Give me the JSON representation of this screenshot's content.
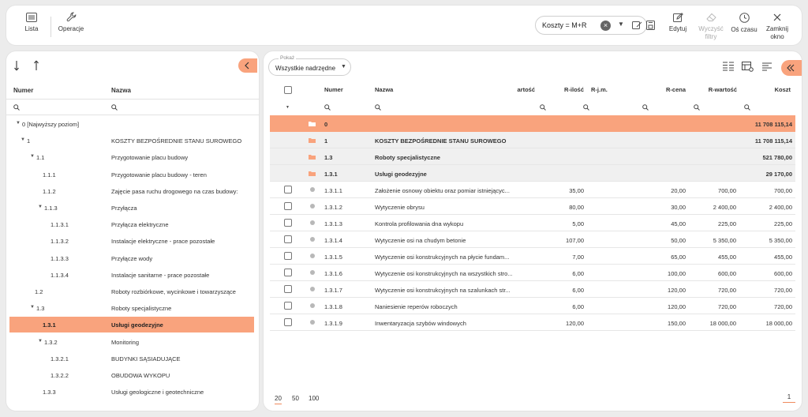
{
  "toolbar": {
    "lista": "Lista",
    "operacje": "Operacje",
    "formula": "Koszty = M+R",
    "edytuj": "Edytuj",
    "wyczysc_1": "Wyczyść",
    "wyczysc_2": "filtry",
    "os_czasu": "Oś czasu",
    "zamknij_1": "Zamknij",
    "zamknij_2": "okno"
  },
  "tree": {
    "col_numer": "Numer",
    "col_nazwa": "Nazwa",
    "rows": [
      {
        "num": "0 [Najwyższy poziom]",
        "name": "",
        "level": 0,
        "expanded": true
      },
      {
        "num": "1",
        "name": "KOSZTY BEZPOŚREDNIE STANU SUROWEGO",
        "level": 1,
        "expanded": true
      },
      {
        "num": "1.1",
        "name": "Przygotowanie placu budowy",
        "level": 2,
        "expanded": true
      },
      {
        "num": "1.1.1",
        "name": "Przygotowanie placu budowy - teren",
        "level": 3
      },
      {
        "num": "1.1.2",
        "name": "Zajęcie pasa ruchu drogowego na czas budowy:",
        "level": 3
      },
      {
        "num": "1.1.3",
        "name": "Przyłącza",
        "level": 3,
        "expanded": true
      },
      {
        "num": "1.1.3.1",
        "name": "Przyłącza elektryczne",
        "level": 4
      },
      {
        "num": "1.1.3.2",
        "name": "Instalacje elektryczne - prace pozostałe",
        "level": 4
      },
      {
        "num": "1.1.3.3",
        "name": "Przyłącze wody",
        "level": 4
      },
      {
        "num": "1.1.3.4",
        "name": "Instalacje sanitarne - prace pozostałe",
        "level": 4
      },
      {
        "num": "1.2",
        "name": "Roboty rozbiórkowe, wycinkowe i towarzyszące",
        "level": 2
      },
      {
        "num": "1.3",
        "name": "Roboty specjalistyczne",
        "level": 2,
        "expanded": true
      },
      {
        "num": "1.3.1",
        "name": "Usługi geodezyjne",
        "level": 3,
        "selected": true
      },
      {
        "num": "1.3.2",
        "name": "Monitoring",
        "level": 3,
        "expanded": true
      },
      {
        "num": "1.3.2.1",
        "name": "BUDYNKI SĄSIADUJĄCE",
        "level": 4
      },
      {
        "num": "1.3.2.2",
        "name": "OBUDOWA WYKOPU",
        "level": 4
      },
      {
        "num": "1.3.3",
        "name": "Usługi geologiczne i geotechniczne",
        "level": 3
      }
    ]
  },
  "grid": {
    "pokaz_label": "Pokaż",
    "pokaz_value": "Wszystkie nadrzędne",
    "columns": {
      "numer": "Numer",
      "nazwa": "Nazwa",
      "wartosc": "artość",
      "r_ilosc": "R-ilość",
      "r_jm": "R-j.m.",
      "r_cena": "R-cena",
      "r_wartosc": "R-wartość",
      "koszt": "Koszt"
    },
    "group_rows": [
      {
        "num": "0",
        "name": "",
        "koszt": "11 708 115,14",
        "style": "root"
      },
      {
        "num": "1",
        "name": "KOSZTY BEZPOŚREDNIE STANU SUROWEGO",
        "koszt": "11 708 115,14",
        "style": "group"
      },
      {
        "num": "1.3",
        "name": "Roboty specjalistyczne",
        "koszt": "521 780,00",
        "style": "group"
      },
      {
        "num": "1.3.1",
        "name": "Usługi geodezyjne",
        "koszt": "29 170,00",
        "style": "group"
      }
    ],
    "rows": [
      {
        "num": "1.3.1.1",
        "name": "Założenie osnowy obiektu oraz pomiar istniejącyc...",
        "r_ilosc": "35,00",
        "r_cena": "20,00",
        "r_wartosc": "700,00",
        "koszt": "700,00"
      },
      {
        "num": "1.3.1.2",
        "name": "Wytyczenie obrysu",
        "r_ilosc": "80,00",
        "r_cena": "30,00",
        "r_wartosc": "2 400,00",
        "koszt": "2 400,00"
      },
      {
        "num": "1.3.1.3",
        "name": "Kontrola profilowania dna wykopu",
        "r_ilosc": "5,00",
        "r_cena": "45,00",
        "r_wartosc": "225,00",
        "koszt": "225,00"
      },
      {
        "num": "1.3.1.4",
        "name": "Wytyczenie osi na chudym betonie",
        "r_ilosc": "107,00",
        "r_cena": "50,00",
        "r_wartosc": "5 350,00",
        "koszt": "5 350,00"
      },
      {
        "num": "1.3.1.5",
        "name": "Wytyczenie osi konstrukcyjnych na płycie fundam...",
        "r_ilosc": "7,00",
        "r_cena": "65,00",
        "r_wartosc": "455,00",
        "koszt": "455,00"
      },
      {
        "num": "1.3.1.6",
        "name": "Wytyczenie osi konstrukcyjnych na wszystkich stro...",
        "r_ilosc": "6,00",
        "r_cena": "100,00",
        "r_wartosc": "600,00",
        "koszt": "600,00"
      },
      {
        "num": "1.3.1.7",
        "name": "Wytyczenie osi konstrukcyjnych na szalunkach str...",
        "r_ilosc": "6,00",
        "r_cena": "120,00",
        "r_wartosc": "720,00",
        "koszt": "720,00"
      },
      {
        "num": "1.3.1.8",
        "name": "Naniesienie reperów roboczych",
        "r_ilosc": "6,00",
        "r_cena": "120,00",
        "r_wartosc": "720,00",
        "koszt": "720,00"
      },
      {
        "num": "1.3.1.9",
        "name": "Inwentaryzacja szybów windowych",
        "r_ilosc": "120,00",
        "r_cena": "150,00",
        "r_wartosc": "18 000,00",
        "koszt": "18 000,00"
      }
    ],
    "page_sizes": [
      "20",
      "50",
      "100"
    ],
    "current_page": "1"
  },
  "colors": {
    "accent": "#f9a37d",
    "group_bg": "#f0f0f0"
  }
}
